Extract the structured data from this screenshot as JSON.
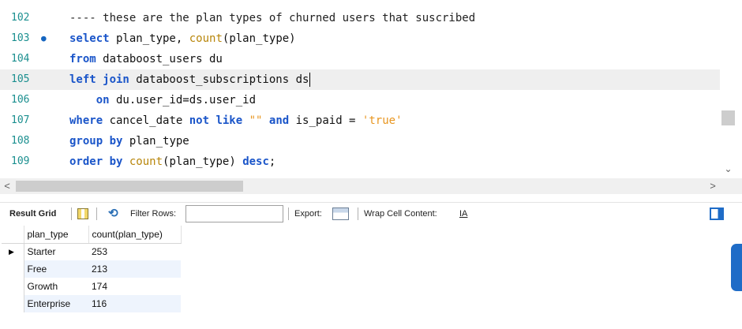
{
  "editor": {
    "lines": [
      {
        "num": "102",
        "current": false,
        "bullet": "",
        "indent": "",
        "tokens": [
          {
            "t": "cm",
            "v": "---- these are the plan types of churned users that suscribed"
          }
        ]
      },
      {
        "num": "103",
        "current": false,
        "bullet": "●",
        "indent": "",
        "tokens": [
          {
            "t": "kw",
            "v": "select"
          },
          {
            "t": "id",
            "v": " plan_type, "
          },
          {
            "t": "fn",
            "v": "count"
          },
          {
            "t": "id",
            "v": "(plan_type)"
          }
        ]
      },
      {
        "num": "104",
        "current": false,
        "bullet": "",
        "indent": "",
        "tokens": [
          {
            "t": "kw",
            "v": "from"
          },
          {
            "t": "id",
            "v": " databoost_users du"
          }
        ]
      },
      {
        "num": "105",
        "current": true,
        "bullet": "",
        "indent": "",
        "tokens": [
          {
            "t": "kw",
            "v": "left join"
          },
          {
            "t": "id",
            "v": " databoost_subscriptions ds"
          }
        ]
      },
      {
        "num": "106",
        "current": false,
        "bullet": "",
        "indent": "    ",
        "tokens": [
          {
            "t": "kw",
            "v": "on"
          },
          {
            "t": "id",
            "v": " du.user_id=ds.user_id"
          }
        ]
      },
      {
        "num": "107",
        "current": false,
        "bullet": "",
        "indent": "",
        "tokens": [
          {
            "t": "kw",
            "v": "where"
          },
          {
            "t": "id",
            "v": " cancel_date "
          },
          {
            "t": "kw",
            "v": "not like"
          },
          {
            "t": "id",
            "v": " "
          },
          {
            "t": "str",
            "v": "\"\""
          },
          {
            "t": "id",
            "v": " "
          },
          {
            "t": "kw",
            "v": "and"
          },
          {
            "t": "id",
            "v": " is_paid = "
          },
          {
            "t": "str",
            "v": "'true'"
          }
        ]
      },
      {
        "num": "108",
        "current": false,
        "bullet": "",
        "indent": "",
        "tokens": [
          {
            "t": "kw",
            "v": "group by"
          },
          {
            "t": "id",
            "v": " plan_type"
          }
        ]
      },
      {
        "num": "109",
        "current": false,
        "bullet": "",
        "indent": "",
        "tokens": [
          {
            "t": "kw",
            "v": "order by"
          },
          {
            "t": "id",
            "v": " "
          },
          {
            "t": "fn",
            "v": "count"
          },
          {
            "t": "id",
            "v": "(plan_type) "
          },
          {
            "t": "kw",
            "v": "desc"
          },
          {
            "t": "id",
            "v": ";"
          }
        ]
      }
    ]
  },
  "scroll": {
    "left_arrow": "<",
    "right_arrow": ">",
    "down_arrow": "⌄"
  },
  "toolbar": {
    "result_grid_label": "Result Grid",
    "filter_rows_label": "Filter Rows:",
    "filter_rows_value": "",
    "export_label": "Export:",
    "wrap_label": "Wrap Cell Content:",
    "wrap_icon_glyph": "IA"
  },
  "grid": {
    "columns": [
      "plan_type",
      "count(plan_type)"
    ],
    "selected_row_marker": "▶",
    "rows": [
      [
        "Starter",
        "253"
      ],
      [
        "Free",
        "213"
      ],
      [
        "Growth",
        "174"
      ],
      [
        "Enterprise",
        "116"
      ]
    ]
  },
  "colors": {
    "keyword": "#1a55c9",
    "function": "#b8860b",
    "string": "#e89620",
    "line_number": "#1b8f8f",
    "accent": "#1f6cc7"
  }
}
